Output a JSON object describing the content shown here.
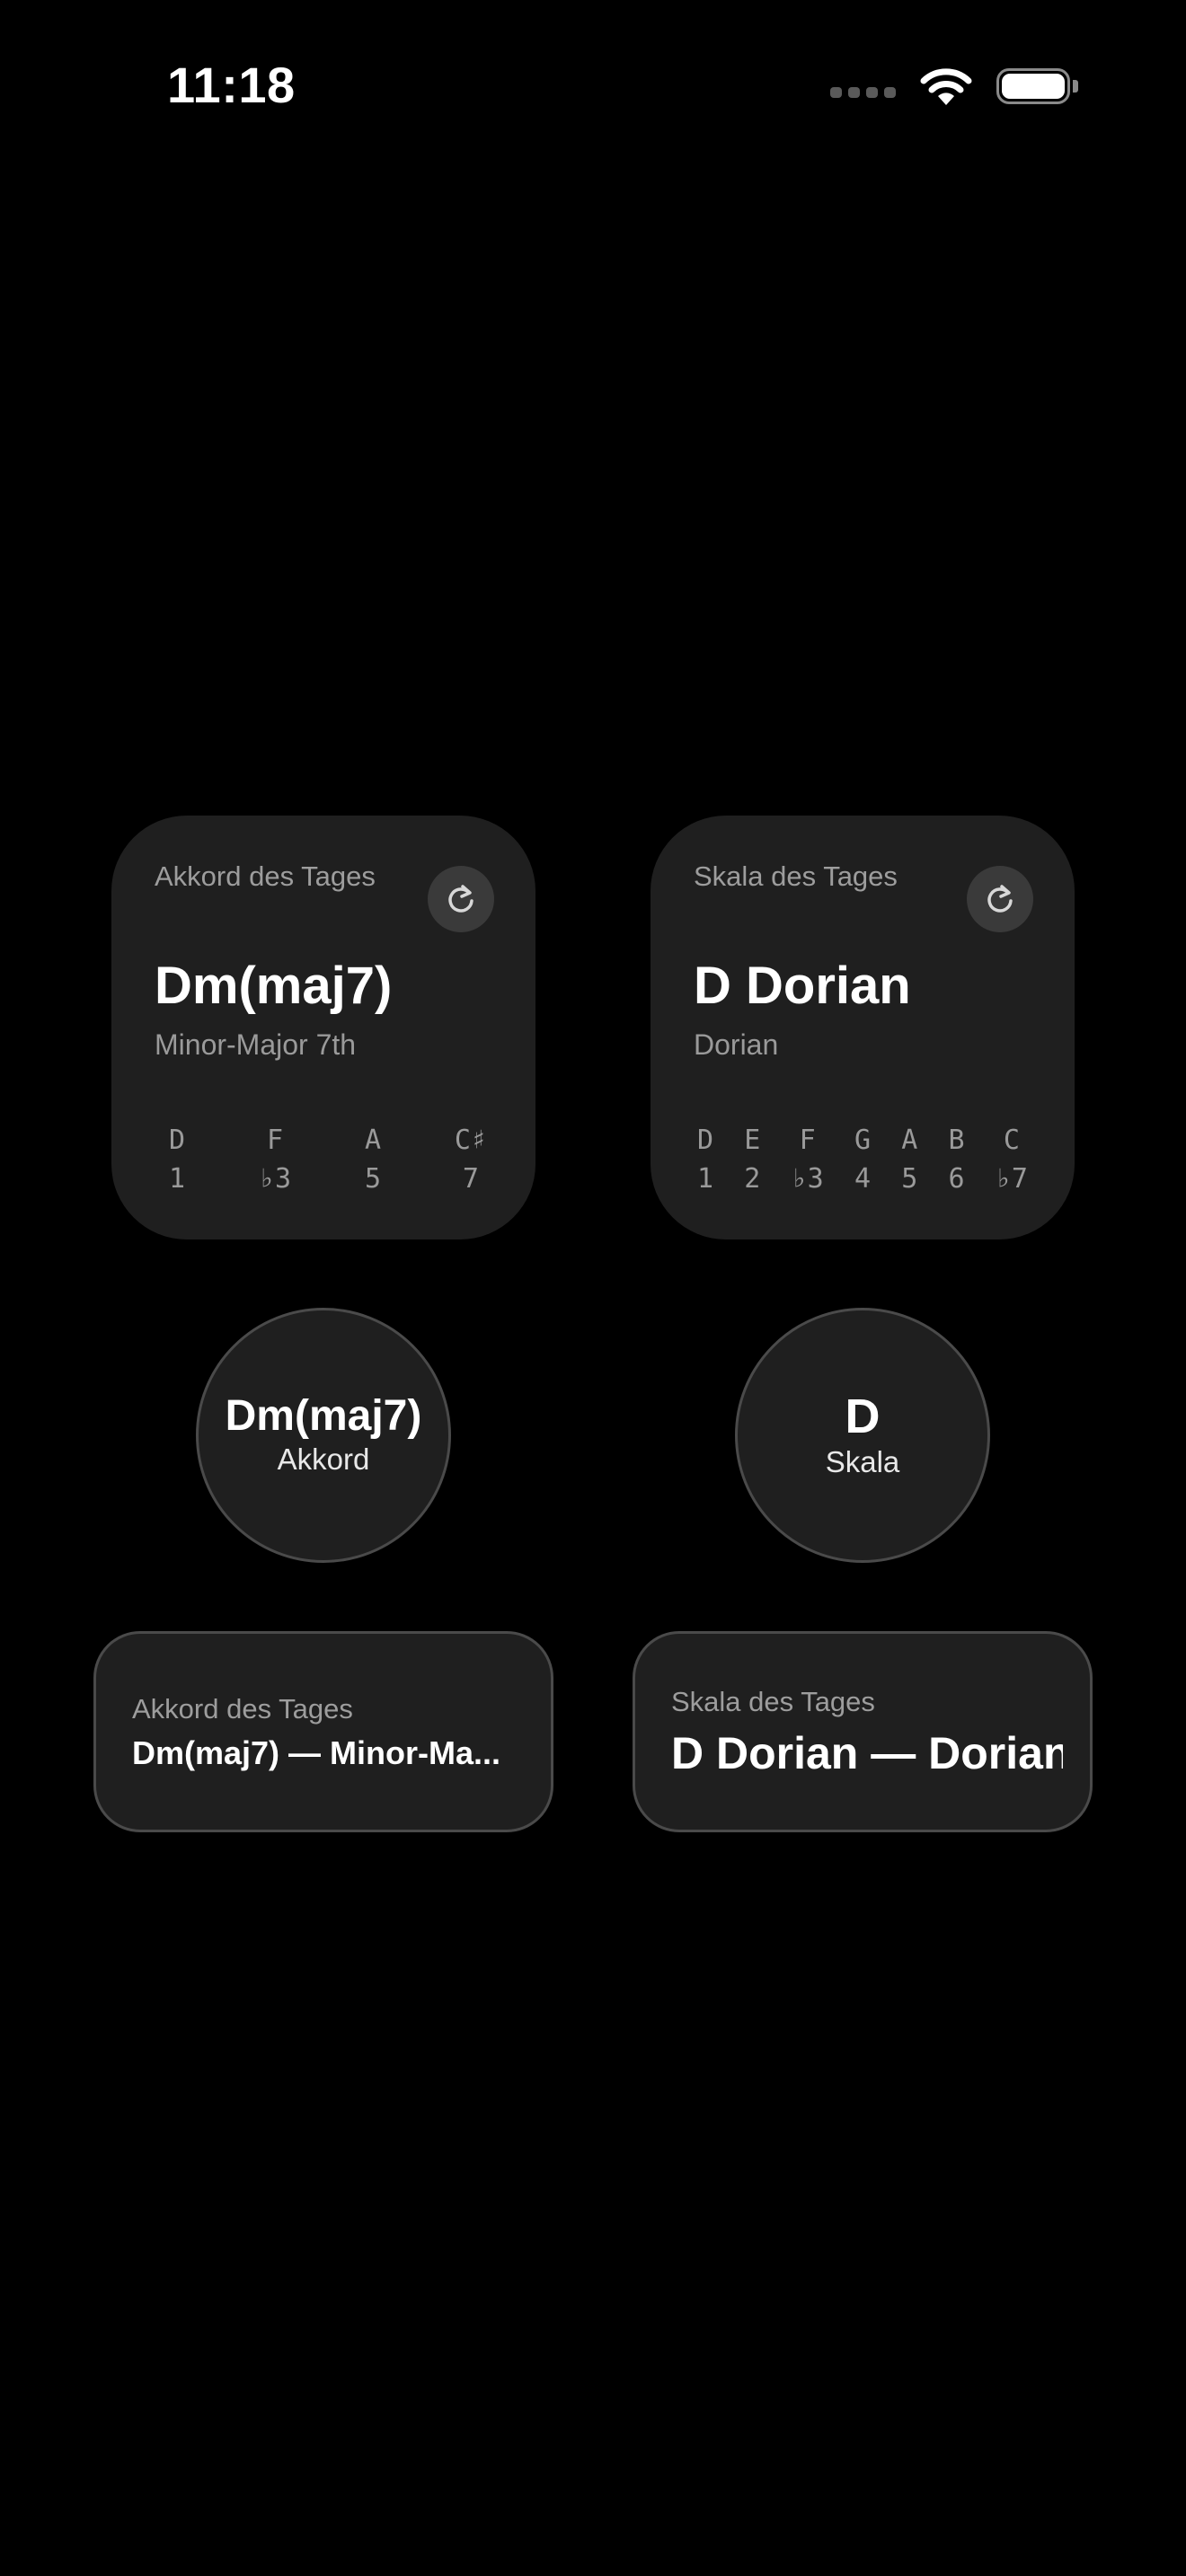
{
  "status_bar": {
    "time": "11:18"
  },
  "chord_widget": {
    "label": "Akkord des Tages",
    "name": "Dm(maj7)",
    "quality": "Minor-Major 7th",
    "refresh_icon": "arrow-clockwise-icon",
    "notes": [
      {
        "note": "D",
        "degree": "1"
      },
      {
        "note": "F",
        "degree": "♭3"
      },
      {
        "note": "A",
        "degree": "5"
      },
      {
        "note": "C♯",
        "degree": "7"
      }
    ]
  },
  "scale_widget": {
    "label": "Skala des Tages",
    "name": "D Dorian",
    "mode": "Dorian",
    "refresh_icon": "arrow-clockwise-icon",
    "notes": [
      {
        "note": "D",
        "degree": "1"
      },
      {
        "note": "E",
        "degree": "2"
      },
      {
        "note": "F",
        "degree": "♭3"
      },
      {
        "note": "G",
        "degree": "4"
      },
      {
        "note": "A",
        "degree": "5"
      },
      {
        "note": "B",
        "degree": "6"
      },
      {
        "note": "C",
        "degree": "♭7"
      }
    ]
  },
  "chord_circle": {
    "main": "Dm(maj7)",
    "sub": "Akkord"
  },
  "scale_circle": {
    "main": "D",
    "sub": "Skala"
  },
  "chord_rect": {
    "label": "Akkord des Tages",
    "text": "Dm(maj7) — Minor-Ma..."
  },
  "scale_rect": {
    "label": "Skala des Tages",
    "text": "D Dorian — Dorian"
  },
  "colors": {
    "background": "#000000",
    "widget": "#1f1f1f",
    "secondary_text": "#9a9a9a"
  }
}
